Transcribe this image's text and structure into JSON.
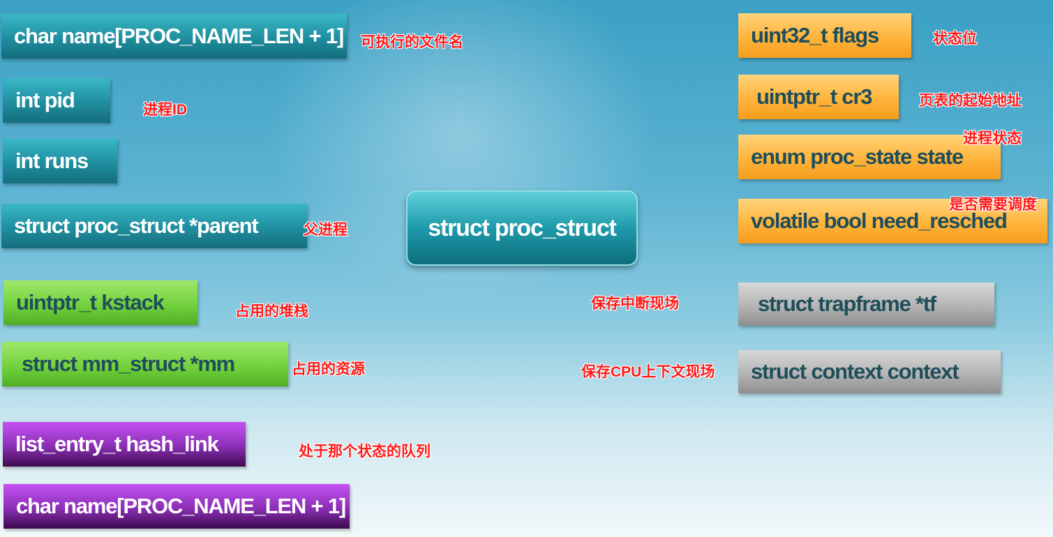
{
  "center": "struct proc_struct",
  "fields": {
    "name": "char name[PROC_NAME_LEN + 1]",
    "pid": "int pid",
    "runs": "int runs",
    "parent": "struct proc_struct *parent",
    "kstack": "uintptr_t kstack",
    "mm": "struct mm_struct *mm",
    "hash_link": "list_entry_t hash_link",
    "name2": "char name[PROC_NAME_LEN + 1]",
    "flags": "uint32_t flags",
    "cr3": "uintptr_t cr3",
    "state": "enum proc_state state",
    "need_resched": "volatile bool need_resched",
    "tf": "struct trapframe *tf",
    "context": "struct context context"
  },
  "notes": {
    "name": "可执行的文件名",
    "pid": "进程ID",
    "parent": "父进程",
    "kstack": "占用的堆栈",
    "mm": "占用的资源",
    "hash_link": "处于那个状态的队列",
    "flags": "状态位",
    "cr3": "页表的起始地址",
    "state": "进程状态",
    "need_resched": "是否需要调度",
    "tf": "保存中断现场",
    "context": "保存CPU上下文现场"
  },
  "colors": {
    "teal": "#1f8e9f",
    "green": "#6fcf3a",
    "purple": "#8a2fb4",
    "orange": "#ffb43c",
    "gray": "#b4b4b4",
    "note": "#ff1a1a"
  }
}
